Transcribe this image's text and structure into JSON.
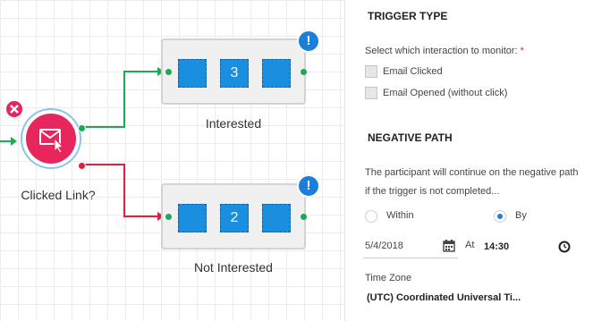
{
  "canvas": {
    "decision": {
      "label": "Clicked Link?",
      "remove_icon": "close-icon",
      "icon": "email-click-icon",
      "color": "#e8265e"
    },
    "nodes": [
      {
        "label": "Interested",
        "count": "3",
        "alert": "!"
      },
      {
        "label": "Not Interested",
        "count": "2",
        "alert": "!"
      }
    ],
    "colors": {
      "positive": "#1aab55",
      "negative": "#d9243f",
      "node_block": "#1a8fe0",
      "alert": "#1a7fd8"
    }
  },
  "panel": {
    "trigger_type": {
      "heading": "TRIGGER TYPE",
      "prompt": "Select which interaction to monitor:",
      "required_mark": "*",
      "options": [
        "Email Clicked",
        "Email Opened (without click)"
      ]
    },
    "negative_path": {
      "heading": "NEGATIVE PATH",
      "description": "The participant will continue on the negative path if the trigger is not completed...",
      "radio_within": "Within",
      "radio_by": "By",
      "selected": "By",
      "date_value": "5/4/2018",
      "at_label": "At",
      "time_value": "14:30",
      "timezone_label": "Time Zone",
      "timezone_value": "(UTC) Coordinated Universal Ti..."
    }
  }
}
